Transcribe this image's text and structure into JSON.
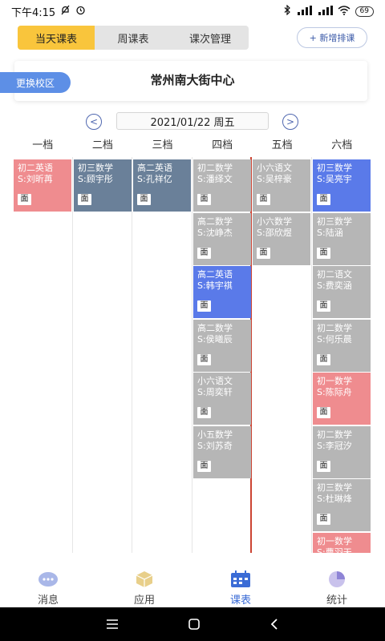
{
  "status": {
    "time": "下午4:15",
    "battery": "69"
  },
  "tabs_top": [
    "当天课表",
    "周课表",
    "课次管理"
  ],
  "add_button": "+ 新增排课",
  "campus": {
    "switch_label": "更换校区",
    "name": "常州南大街中心"
  },
  "date_bar": {
    "prev": "<",
    "date": "2021/01/22 周五",
    "next": ">"
  },
  "columns": [
    "一档",
    "二档",
    "三档",
    "四档",
    "五档",
    "六档"
  ],
  "face_tag": "面",
  "lessons": [
    {
      "col": 0,
      "row": 0,
      "title": "初二英语",
      "student": "S:刘昕苒",
      "color": "#ef8c8f"
    },
    {
      "col": 1,
      "row": 0,
      "title": "初三数学",
      "student": "S:顾宇彤",
      "color": "#6a8099"
    },
    {
      "col": 2,
      "row": 0,
      "title": "高二英语",
      "student": "S:孔祥亿",
      "color": "#6a8099"
    },
    {
      "col": 3,
      "row": 0,
      "title": "初二数学",
      "student": "S:潘绎文",
      "color": "#b6b6b6"
    },
    {
      "col": 3,
      "row": 1,
      "title": "高二数学",
      "student": "S:沈峥杰",
      "color": "#b6b6b6"
    },
    {
      "col": 3,
      "row": 2,
      "title": "高二英语",
      "student": "S:韩宇祺",
      "color": "#5a7ae9"
    },
    {
      "col": 3,
      "row": 3,
      "title": "高二数学",
      "student": "S:侯曦辰",
      "color": "#b6b6b6"
    },
    {
      "col": 3,
      "row": 4,
      "title": "小六语文",
      "student": "S:周奕轩",
      "color": "#b6b6b6"
    },
    {
      "col": 3,
      "row": 5,
      "title": "小五数学",
      "student": "S:刘苏奇",
      "color": "#b6b6b6"
    },
    {
      "col": 4,
      "row": 0,
      "title": "小六语文",
      "student": "S:吴梓豪",
      "color": "#b6b6b6"
    },
    {
      "col": 4,
      "row": 1,
      "title": "小六数学",
      "student": "S:邵欣煜",
      "color": "#b6b6b6"
    },
    {
      "col": 5,
      "row": 0,
      "title": "初三数学",
      "student": "S:吴亮宇",
      "color": "#5a7ae9"
    },
    {
      "col": 5,
      "row": 1,
      "title": "初三数学",
      "student": "S:陆涵",
      "color": "#b6b6b6"
    },
    {
      "col": 5,
      "row": 2,
      "title": "初二语文",
      "student": "S:费奕涵",
      "color": "#b6b6b6"
    },
    {
      "col": 5,
      "row": 3,
      "title": "初二数学",
      "student": "S:何乐晨",
      "color": "#b6b6b6"
    },
    {
      "col": 5,
      "row": 4,
      "title": "初一数学",
      "student": "S:陈际舟",
      "color": "#ef8c8f"
    },
    {
      "col": 5,
      "row": 5,
      "title": "初二数学",
      "student": "S:李冠汐",
      "color": "#b6b6b6"
    },
    {
      "col": 5,
      "row": 6,
      "title": "初三数学",
      "student": "S:杜琳烽",
      "color": "#b6b6b6"
    },
    {
      "col": 5,
      "row": 7,
      "title": "初一数学",
      "student": "S:曹羽天",
      "color": "#ef8c8f"
    }
  ],
  "bottom_tabs": [
    {
      "label": "消息",
      "icon": "chat-icon"
    },
    {
      "label": "应用",
      "icon": "box-icon"
    },
    {
      "label": "课表",
      "icon": "calendar-icon"
    },
    {
      "label": "统计",
      "icon": "pie-chart-icon"
    }
  ],
  "colors": {
    "accent_yellow": "#f9c53c",
    "accent_blue": "#3b6cd6",
    "current_line": "#cc4433"
  }
}
